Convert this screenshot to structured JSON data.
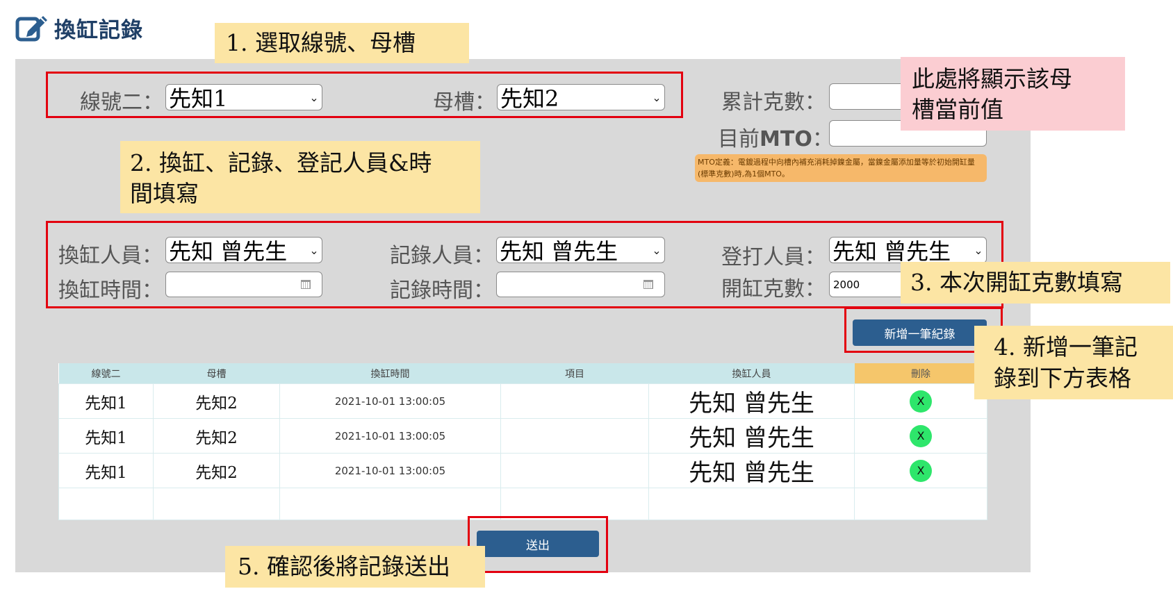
{
  "header": {
    "title": "換缸記錄",
    "icon": "edit-icon"
  },
  "form": {
    "line_label": "線號二：",
    "line_value": "先知1",
    "tank_label": "母槽：",
    "tank_value": "先知2",
    "cumulative_label": "累計克數：",
    "cumulative_value": "",
    "mto_label_prefix": "目前",
    "mto_label_bold": "MTO",
    "mto_label_suffix": "：",
    "mto_value": "",
    "mto_definition": "MTO定義：電鍍過程中向槽內補充消耗掉鎳金屬，當鎳金屬添加量等於初始開缸量(標準克數)時,為1個MTO。",
    "changer_label": "換缸人員：",
    "changer_value": "先知 曾先生",
    "recorder_label": "記錄人員：",
    "recorder_value": "先知 曾先生",
    "typist_label": "登打人員：",
    "typist_value": "先知 曾先生",
    "change_time_label": "換缸時間：",
    "change_time_value": "",
    "record_time_label": "記錄時間：",
    "record_time_value": "",
    "open_grams_label": "開缸克數：",
    "open_grams_value": "2000",
    "add_button": "新增一筆紀錄",
    "submit_button": "送出"
  },
  "table": {
    "headers": [
      "線號二",
      "母槽",
      "換缸時間",
      "項目",
      "換缸人員",
      "刪除"
    ],
    "rows": [
      {
        "line": "先知1",
        "tank": "先知2",
        "time": "2021-10-01 13:00:05",
        "item": "",
        "person": "先知 曾先生",
        "delete": "X"
      },
      {
        "line": "先知1",
        "tank": "先知2",
        "time": "2021-10-01 13:00:05",
        "item": "",
        "person": "先知 曾先生",
        "delete": "X"
      },
      {
        "line": "先知1",
        "tank": "先知2",
        "time": "2021-10-01 13:00:05",
        "item": "",
        "person": "先知 曾先生",
        "delete": "X"
      }
    ]
  },
  "annotations": {
    "step1": "1.  選取線號、母槽",
    "step2_line1": "2. 換缸、記錄、登記人員&時",
    "step2_line2": "間填寫",
    "step3": "3. 本次開缸克數填寫",
    "step4_line1": "4. 新增一筆記",
    "step4_line2": "錄到下方表格",
    "step5": "5. 確認後將記錄送出",
    "current_value_line1": "此處將顯示該母",
    "current_value_line2": "槽當前值"
  },
  "colors": {
    "accent": "#2c5e8f",
    "highlight_box": "#e3000f",
    "note_yellow": "#fce5a4",
    "note_pink": "#fbcdd2",
    "delete_green": "#2ee66b"
  }
}
